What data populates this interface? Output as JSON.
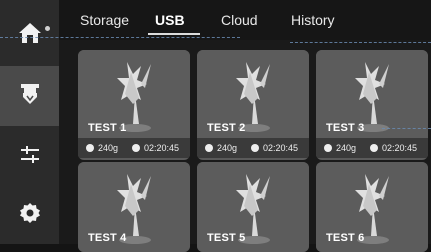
{
  "tabs": [
    {
      "label": "Storage",
      "active": false
    },
    {
      "label": "USB",
      "active": true
    },
    {
      "label": "Cloud",
      "active": false
    },
    {
      "label": "History",
      "active": false
    }
  ],
  "sidebar": {
    "items": [
      {
        "name": "home",
        "icon": "home-icon",
        "active": false
      },
      {
        "name": "print",
        "icon": "printer-icon",
        "active": true
      },
      {
        "name": "controls",
        "icon": "sliders-icon",
        "active": false
      },
      {
        "name": "settings",
        "icon": "gear-icon",
        "active": false
      }
    ]
  },
  "files": [
    {
      "title": "TEST 1",
      "weight": "240g",
      "time": "02:20:45"
    },
    {
      "title": "TEST 2",
      "weight": "240g",
      "time": "02:20:45"
    },
    {
      "title": "TEST 3",
      "weight": "240g",
      "time": "02:20:45"
    },
    {
      "title": "TEST 4"
    },
    {
      "title": "TEST 5"
    },
    {
      "title": "TEST 6"
    }
  ],
  "colors": {
    "background": "#141414",
    "sidebar": "#2b2b2b",
    "active": "#4a4a4a",
    "card": "#5a5a5a",
    "meta_bar": "#3a3a3a",
    "guide": "#6a8ab0"
  }
}
